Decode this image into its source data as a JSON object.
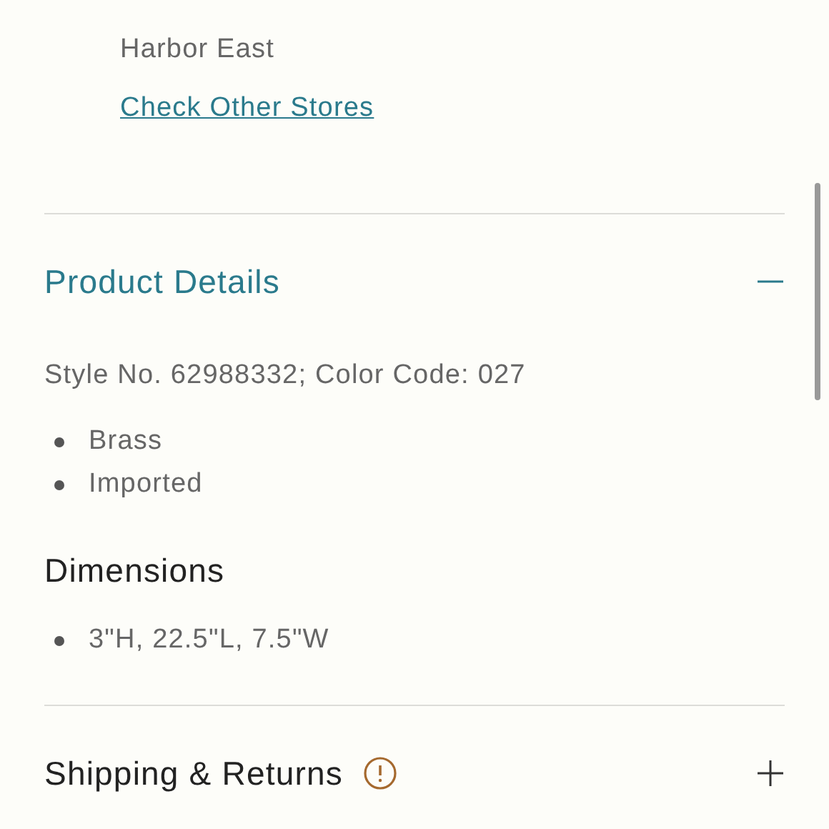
{
  "store": {
    "name": "Harbor East",
    "link": "Check Other Stores"
  },
  "sections": [
    {
      "title": "Product Details",
      "expanded": true,
      "alert": false,
      "style_line": "Style No. 62988332; Color Code: 027",
      "bullets": [
        "Brass",
        "Imported"
      ],
      "subsections": [
        {
          "title": "Dimensions",
          "bullets": [
            "3\"H, 22.5\"L, 7.5\"W"
          ]
        }
      ]
    },
    {
      "title": "Shipping & Returns",
      "expanded": false,
      "alert": true
    }
  ]
}
